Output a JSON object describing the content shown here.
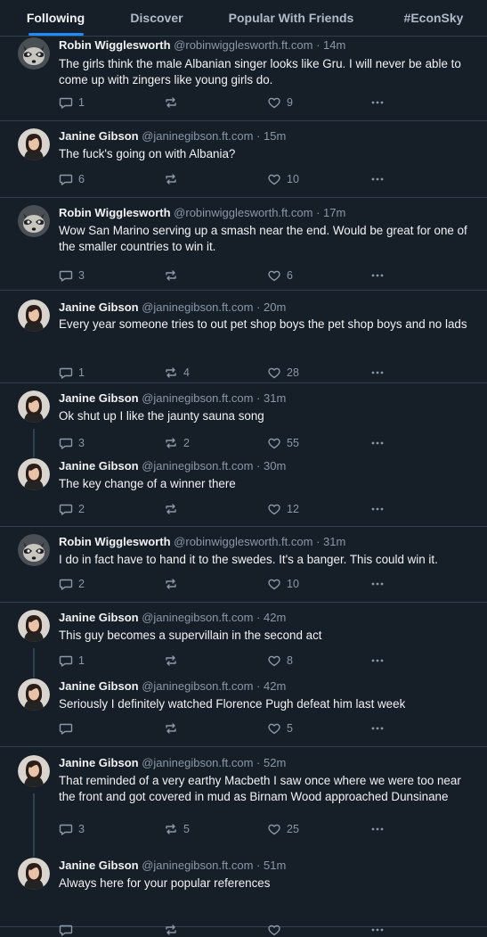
{
  "tabs": [
    {
      "label": "Following",
      "active": true
    },
    {
      "label": "Discover",
      "active": false
    },
    {
      "label": "Popular With Friends",
      "active": false
    },
    {
      "label": "#EconSky",
      "active": false
    }
  ],
  "colors": {
    "background": "#161e27",
    "divider": "#2e4052",
    "text": "#f1f3f5",
    "muted": "#8a98a8",
    "accent": "#208bfe"
  },
  "icons": {
    "reply": "speech-bubble-icon",
    "repost": "repost-arrows-icon",
    "like": "heart-icon",
    "more": "ellipsis-icon",
    "avatar_robin": "raccoon-avatar",
    "avatar_janine": "woman-portrait-avatar"
  },
  "posts": [
    {
      "author": "Robin Wigglesworth",
      "handle": "@robinwigglesworth.ft.com",
      "separator": "·",
      "time": "14m",
      "text": "The girls think the male Albanian singer looks like Gru. I will never be able to come up with zingers like young girls do.",
      "replies": "1",
      "reposts": "",
      "likes": "9",
      "thread_next": false
    },
    {
      "author": "Janine Gibson",
      "handle": "@janinegibson.ft.com",
      "separator": "·",
      "time": "15m",
      "text": "The fuck's going on with Albania?",
      "replies": "6",
      "reposts": "",
      "likes": "10",
      "thread_next": false
    },
    {
      "author": "Robin Wigglesworth",
      "handle": "@robinwigglesworth.ft.com",
      "separator": "·",
      "time": "17m",
      "text": "Wow San Marino serving up a smash near the end. Would be great for one of the smaller countries to win it.",
      "replies": "3",
      "reposts": "",
      "likes": "6",
      "thread_next": false
    },
    {
      "author": "Janine Gibson",
      "handle": "@janinegibson.ft.com",
      "separator": "·",
      "time": "20m",
      "text": "Every year someone tries to out pet shop boys the pet shop boys and no lads",
      "replies": "1",
      "reposts": "4",
      "likes": "28",
      "thread_next": false
    },
    {
      "author": "Janine Gibson",
      "handle": "@janinegibson.ft.com",
      "separator": "·",
      "time": "31m",
      "text": "Ok shut up I like the jaunty sauna song",
      "replies": "3",
      "reposts": "2",
      "likes": "55",
      "thread_next": true
    },
    {
      "author": "Janine Gibson",
      "handle": "@janinegibson.ft.com",
      "separator": "·",
      "time": "30m",
      "text": "The key change of a winner there",
      "replies": "2",
      "reposts": "",
      "likes": "12",
      "thread_next": false
    },
    {
      "author": "Robin Wigglesworth",
      "handle": "@robinwigglesworth.ft.com",
      "separator": "·",
      "time": "31m",
      "text": "I do in fact have to hand it to the swedes. It's a banger. This could win it.",
      "replies": "2",
      "reposts": "",
      "likes": "10",
      "thread_next": false
    },
    {
      "author": "Janine Gibson",
      "handle": "@janinegibson.ft.com",
      "separator": "·",
      "time": "42m",
      "text": "This guy becomes a supervillain in the second act",
      "replies": "1",
      "reposts": "",
      "likes": "8",
      "thread_next": true
    },
    {
      "author": "Janine Gibson",
      "handle": "@janinegibson.ft.com",
      "separator": "·",
      "time": "42m",
      "text": "Seriously I definitely watched Florence Pugh defeat him last week",
      "replies": "",
      "reposts": "",
      "likes": "5",
      "thread_next": false
    },
    {
      "author": "Janine Gibson",
      "handle": "@janinegibson.ft.com",
      "separator": "·",
      "time": "52m",
      "text": "That reminded of a very earthy Macbeth I saw once where we were too near the front and got covered in mud as Birnam Wood approached Dunsinane",
      "replies": "3",
      "reposts": "5",
      "likes": "25",
      "thread_next": true
    },
    {
      "author": "Janine Gibson",
      "handle": "@janinegibson.ft.com",
      "separator": "·",
      "time": "51m",
      "text": "Always here for your popular references",
      "replies": "",
      "reposts": "",
      "likes": "",
      "thread_next": false
    }
  ]
}
